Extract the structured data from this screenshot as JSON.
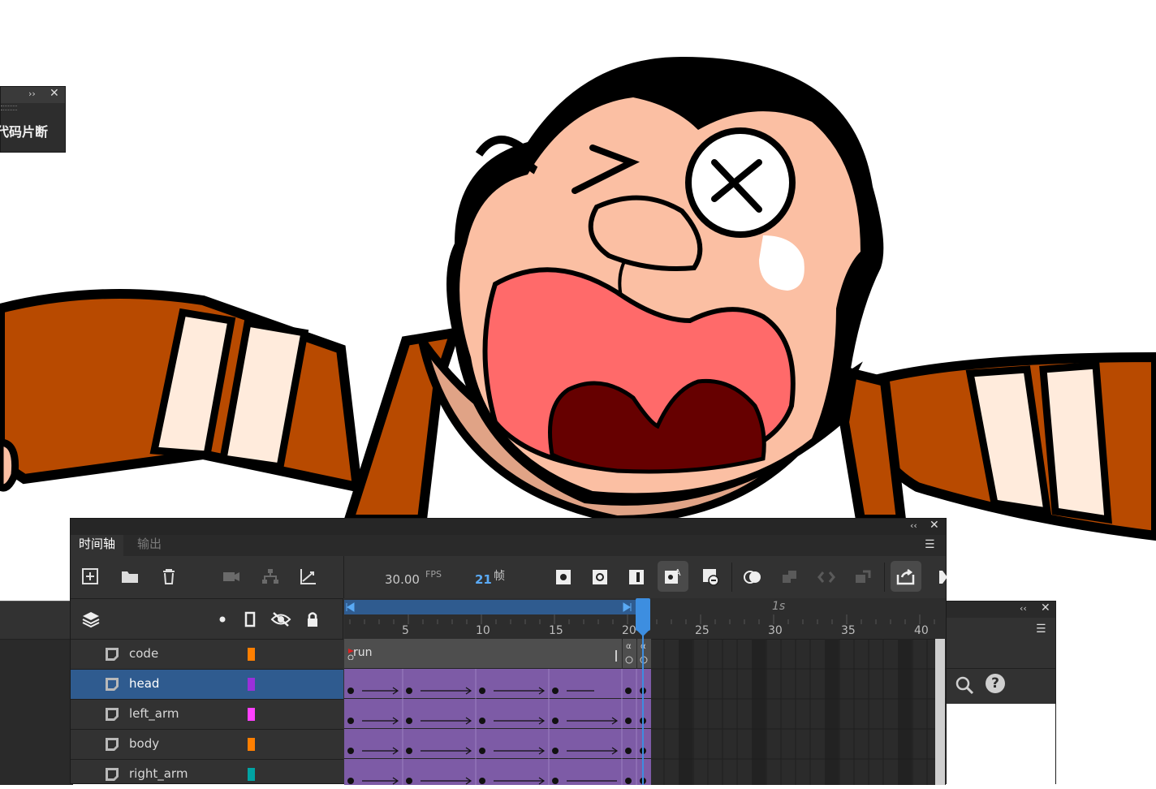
{
  "floating_panel": {
    "label": "代码片断",
    "collapse_glyph": "››",
    "close_glyph": "✕"
  },
  "timeline": {
    "collapse_glyph": "‹‹",
    "close_glyph": "✕",
    "tabs": [
      {
        "label": "时间轴",
        "active": true
      },
      {
        "label": "输出",
        "active": false
      }
    ],
    "fps_value": "30.00",
    "fps_unit": "FPS",
    "current_frame": "21",
    "frame_unit": "帧",
    "ruler": {
      "one_second_label": "1s",
      "ticks": [
        "5",
        "10",
        "15",
        "20",
        "25",
        "30",
        "35",
        "40"
      ]
    },
    "frame_label": "run",
    "layers": [
      {
        "name": "code",
        "color": "#ff7f00",
        "selected": false
      },
      {
        "name": "head",
        "color": "#9b30d9",
        "selected": true
      },
      {
        "name": "left_arm",
        "color": "#ff40ff",
        "selected": false
      },
      {
        "name": "body",
        "color": "#ff7f00",
        "selected": false
      },
      {
        "name": "right_arm",
        "color": "#00a3a3",
        "selected": false
      }
    ]
  },
  "right_panel": {
    "collapse_glyph": "‹‹",
    "close_glyph": "✕",
    "help_glyph": "?"
  },
  "icons": {
    "new_layer": "plus-square-icon",
    "new_folder": "folder-icon",
    "delete": "trash-icon",
    "camera": "camera-icon",
    "parent": "hierarchy-icon",
    "graph": "graph-icon",
    "layers": "layers-icon",
    "show_all": "dot-icon",
    "outline": "outline-icon",
    "visibility": "eye-off-icon",
    "lock": "lock-icon",
    "search": "search-icon",
    "help": "help-icon"
  },
  "colors": {
    "tween_purple": "#7d5ba6",
    "selected_row": "#2f5b8f",
    "playhead": "#3d8ee0",
    "panel_dark": "#323232"
  }
}
